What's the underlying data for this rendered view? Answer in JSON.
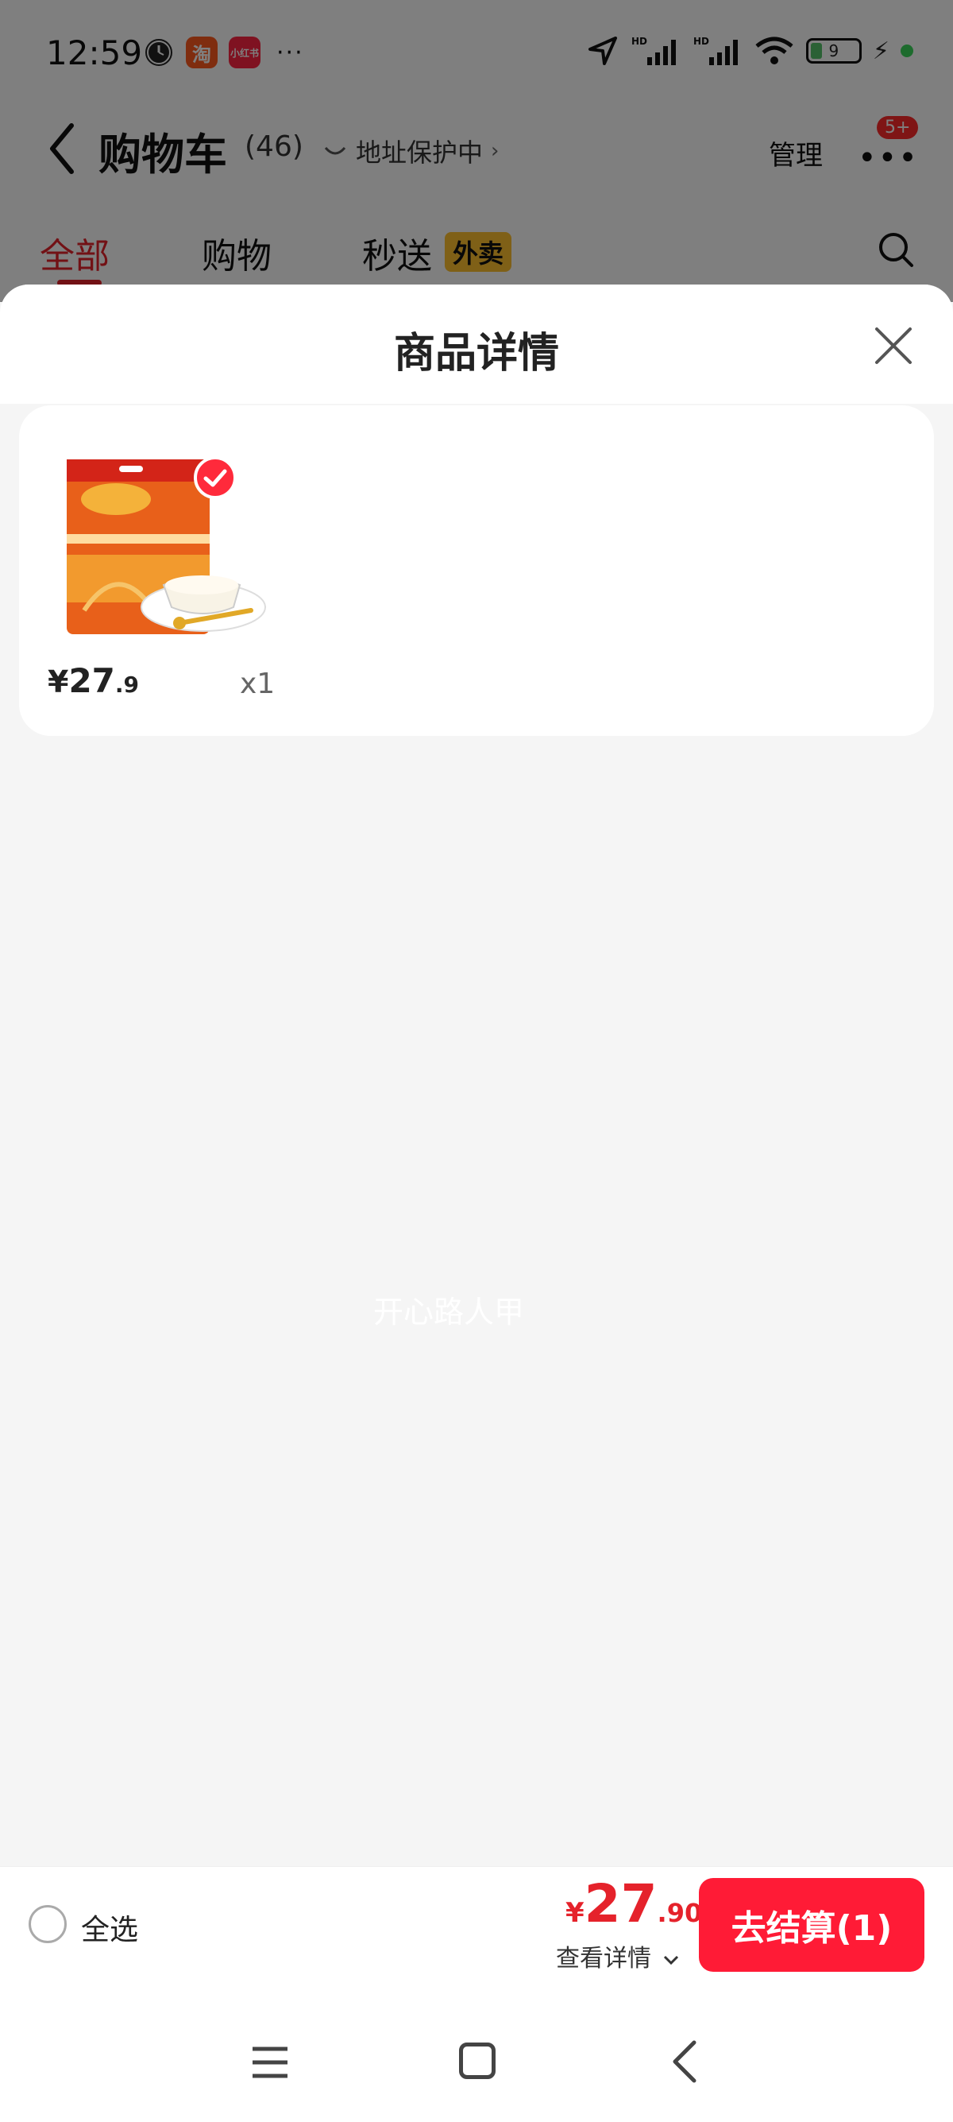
{
  "status_bar": {
    "time": "12:59",
    "more": "···",
    "battery": "9",
    "taobao_icon_label": "淘",
    "xhs_icon_label": "小红书"
  },
  "header": {
    "title": "购物车",
    "count": "(46)",
    "address_protection": "地址保护中",
    "manage": "管理",
    "more_badge": "5+"
  },
  "tabs": {
    "items": [
      "全部",
      "购物",
      "秒送"
    ],
    "waimai_badge": "外卖"
  },
  "sheet": {
    "title": "商品详情"
  },
  "product": {
    "price_symbol": "¥",
    "price_int": "27",
    "price_dec": ".9",
    "quantity": "x1"
  },
  "watermark": "开心路人甲",
  "bottom_bar": {
    "select_all": "全选",
    "total_symbol": "¥",
    "total_int": "27",
    "total_dec": ".90",
    "view_details": "查看详情",
    "checkout": "去结算(1)"
  },
  "colors": {
    "accent_red": "#e5222b",
    "checkout_red": "#ff1b36",
    "waimai_yellow": "#ffc02e"
  }
}
